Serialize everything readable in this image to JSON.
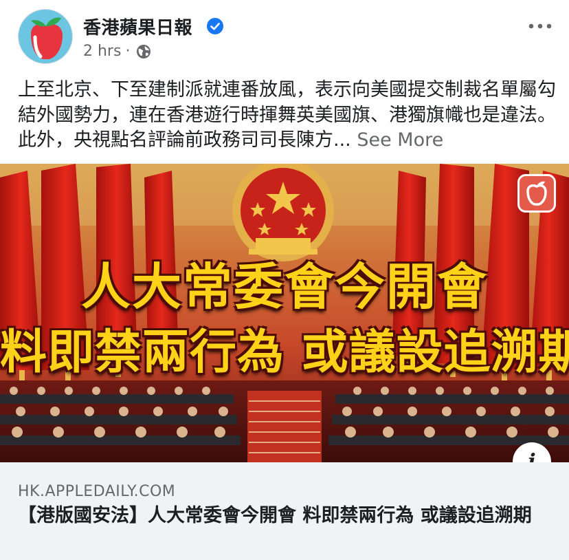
{
  "post": {
    "page_name": "香港蘋果日報",
    "timestamp": "2 hrs",
    "separator": "·",
    "text": "上至北京、下至建制派就連番放風，表示向美國提交制裁名單屬勾結外國勢力，連在香港遊行時揮舞英美國旗、港獨旗幟也是違法。此外，央視點名評論前政務司司長陳方...",
    "see_more": "See More"
  },
  "link": {
    "image_headline_line1": "人大常委會今開會",
    "image_headline_line2": "料即禁兩行為 或議設追溯期",
    "info_label": "i",
    "domain": "HK.APPLEDAILY.COM",
    "title": "【港版國安法】人大常委會今開會 料即禁兩行為 或議設追溯期"
  },
  "icons": {
    "verified": "verified-badge-icon",
    "privacy": "globe-icon",
    "more": "more-options-icon",
    "brand": "apple-daily-logo-icon"
  },
  "colors": {
    "verified_blue": "#1877f2",
    "secondary_text": "#65676b",
    "primary_text": "#1c1e21",
    "footer_bg": "#f0f2f5",
    "headline_yellow": "#ffd21a"
  }
}
